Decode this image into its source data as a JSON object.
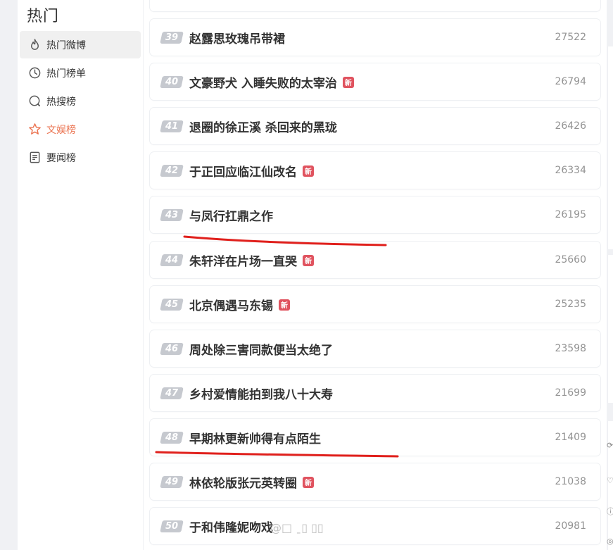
{
  "sidebar": {
    "title": "热门",
    "items": [
      {
        "label": "热门微博",
        "icon": "flame-icon"
      },
      {
        "label": "热门榜单",
        "icon": "clock-icon"
      },
      {
        "label": "热搜榜",
        "icon": "search-icon"
      },
      {
        "label": "文娱榜",
        "icon": "star-icon"
      },
      {
        "label": "要闻榜",
        "icon": "document-icon"
      }
    ]
  },
  "hot_list": [
    {
      "rank": "39",
      "title": "赵露思玫瑰吊带裙",
      "heat": "27522",
      "new": false
    },
    {
      "rank": "40",
      "title": "文豪野犬 入睡失败的太宰治",
      "heat": "26794",
      "new": true
    },
    {
      "rank": "41",
      "title": "退圈的徐正溪 杀回来的黑珑",
      "heat": "26426",
      "new": false
    },
    {
      "rank": "42",
      "title": "于正回应临江仙改名",
      "heat": "26334",
      "new": true
    },
    {
      "rank": "43",
      "title": "与凤行扛鼎之作",
      "heat": "26195",
      "new": false
    },
    {
      "rank": "44",
      "title": "朱轩洋在片场一直哭",
      "heat": "25660",
      "new": true
    },
    {
      "rank": "45",
      "title": "北京偶遇马东锡",
      "heat": "25235",
      "new": true
    },
    {
      "rank": "46",
      "title": "周处除三害同款便当太绝了",
      "heat": "23598",
      "new": false
    },
    {
      "rank": "47",
      "title": "乡村爱情能拍到我八十大寿",
      "heat": "21699",
      "new": false
    },
    {
      "rank": "48",
      "title": "早期林更新帅得有点陌生",
      "heat": "21409",
      "new": false
    },
    {
      "rank": "49",
      "title": "林依轮版张元英转圈",
      "heat": "21038",
      "new": true
    },
    {
      "rank": "50",
      "title": "于和伟隆妮吻戏",
      "heat": "20981",
      "new": false
    }
  ],
  "badge_label": "新",
  "colors": {
    "accent": "#eb7350",
    "badge": "#e0535f",
    "rank_bg": "#c6c9cf",
    "annotation": "#e0201c"
  }
}
